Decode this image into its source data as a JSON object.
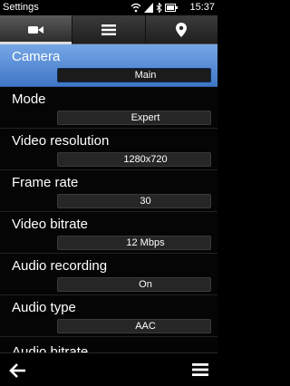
{
  "status": {
    "title": "Settings",
    "time": "15:37"
  },
  "tabs": [
    {
      "icon": "video-camera-icon",
      "active": true
    },
    {
      "icon": "list-icon",
      "active": false
    },
    {
      "icon": "location-pin-icon",
      "active": false
    }
  ],
  "settings": [
    {
      "label": "Camera",
      "value": "Main",
      "selected": true
    },
    {
      "label": "Mode",
      "value": "Expert"
    },
    {
      "label": "Video resolution",
      "value": "1280x720"
    },
    {
      "label": "Frame rate",
      "value": "30"
    },
    {
      "label": "Video bitrate",
      "value": "12 Mbps"
    },
    {
      "label": "Audio recording",
      "value": "On"
    },
    {
      "label": "Audio type",
      "value": "AAC"
    },
    {
      "label": "Audio bitrate",
      "value": ""
    }
  ],
  "toolbar": {
    "back_icon": "back-arrow-icon",
    "menu_icon": "menu-icon"
  },
  "colors": {
    "selection": "#4f86d4",
    "background": "#050505"
  }
}
